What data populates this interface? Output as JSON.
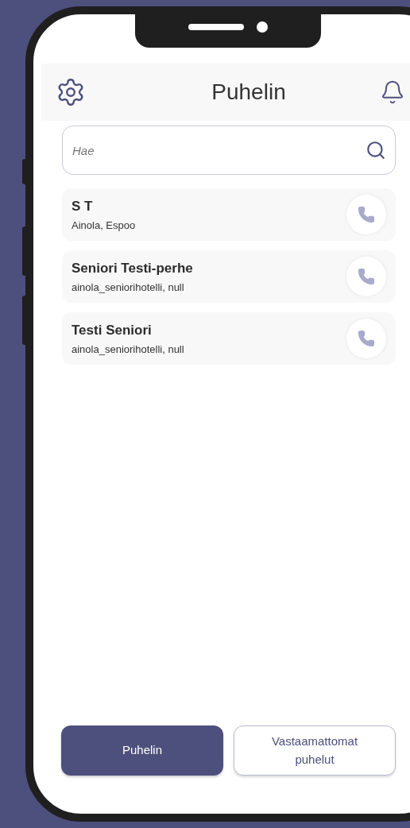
{
  "header": {
    "title": "Puhelin"
  },
  "search": {
    "placeholder": "Hae"
  },
  "contacts": [
    {
      "name": "S T",
      "location": "Ainola, Espoo"
    },
    {
      "name": "Seniori Testi-perhe",
      "location": "ainola_seniorihotelli, null"
    },
    {
      "name": "Testi Seniori",
      "location": "ainola_seniorihotelli, null"
    }
  ],
  "tabs": [
    {
      "label": "Puhelin",
      "selected": true
    },
    {
      "label": "Vastaamattomat puhelut",
      "selected": false
    }
  ]
}
